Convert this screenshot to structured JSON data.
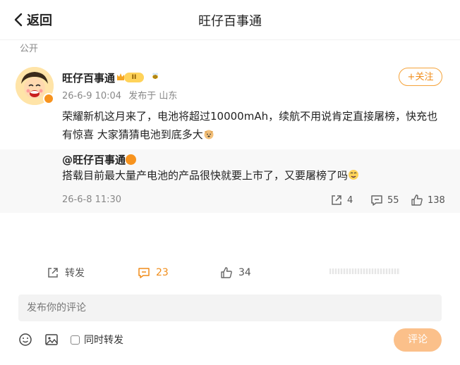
{
  "header": {
    "back_label": "返回",
    "title": "旺仔百事通"
  },
  "visibility": "公开",
  "post": {
    "author": "旺仔百事通",
    "level_badge": "II",
    "date": "26-6-9 10:04",
    "source": "发布于 山东",
    "follow_label": "+关注",
    "text": "荣耀新机这月来了，电池将超过10000mAh，续航不用说肯定直接屠榜，快充也有惊喜 大家猜猜电池到底多大"
  },
  "quote": {
    "author": "@旺仔百事通",
    "text": "搭载目前最大量产电池的产品很快就要上市了，又要屠榜了吗",
    "date": "26-6-8 11:30",
    "reposts": "4",
    "comments": "55",
    "likes": "138"
  },
  "actions": {
    "repost_label": "转发",
    "comments": "23",
    "likes": "34"
  },
  "composer": {
    "placeholder": "发布你的评论",
    "sync_label": "同时转发",
    "submit_label": "评论"
  },
  "colors": {
    "accent": "#f08c19",
    "submit_bg": "#fbc08a",
    "verified": "#f7931e"
  },
  "icons": [
    "chevron-left-icon",
    "crown-icon",
    "bee-icon",
    "verified-icon",
    "share-icon",
    "comment-icon",
    "like-icon",
    "emoji-icon",
    "image-icon"
  ]
}
